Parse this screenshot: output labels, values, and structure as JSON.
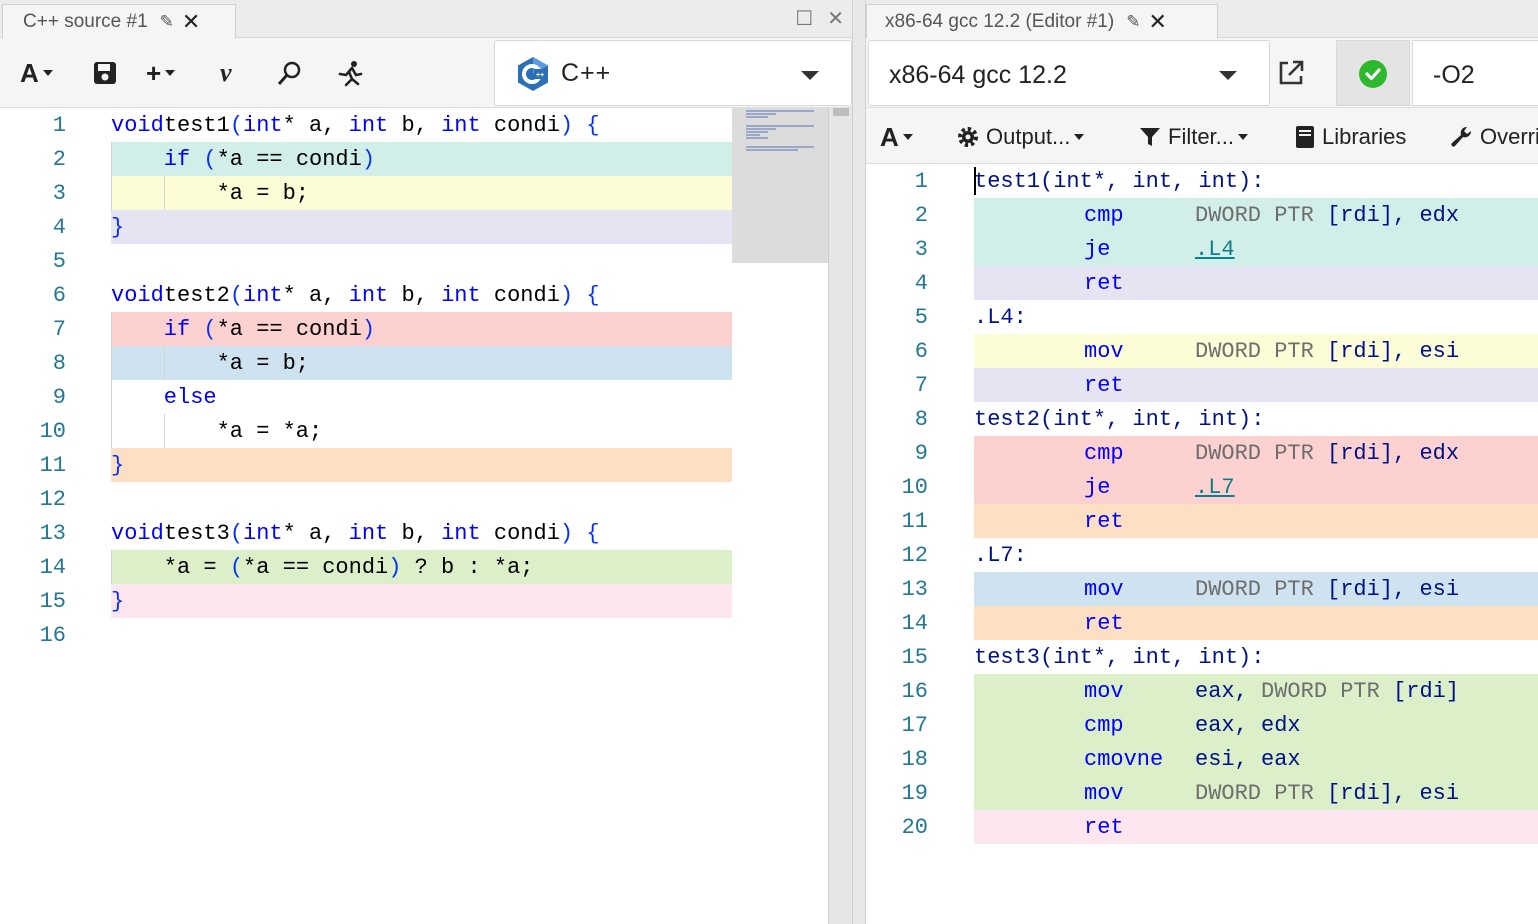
{
  "left_pane": {
    "tab": {
      "title": "C++ source #1"
    },
    "toolbar": {
      "language": "C++"
    },
    "source_lines": [
      {
        "n": "1",
        "hl": "",
        "indent": 0,
        "tokens": [
          [
            "kw",
            "void"
          ],
          [
            "",
            "test1"
          ],
          [
            "br",
            "("
          ],
          [
            "kw",
            "int"
          ],
          [
            "",
            "* a, "
          ],
          [
            "kw",
            "int"
          ],
          [
            "",
            " b, "
          ],
          [
            "kw",
            "int"
          ],
          [
            "",
            " condi"
          ],
          [
            "br",
            ")"
          ],
          [
            "",
            " "
          ],
          [
            "br",
            "{"
          ]
        ]
      },
      {
        "n": "2",
        "hl": "#d1efe8",
        "indent": 1,
        "tokens": [
          [
            "kw",
            "if"
          ],
          [
            "",
            " "
          ],
          [
            "br",
            "("
          ],
          [
            "",
            "*a == condi"
          ],
          [
            "br",
            ")"
          ]
        ]
      },
      {
        "n": "3",
        "hl": "#fcfcd6",
        "indent": 2,
        "tokens": [
          [
            "",
            "*a = b;"
          ]
        ]
      },
      {
        "n": "4",
        "hl": "#e6e3f2",
        "indent": 0,
        "tokens": [
          [
            "br",
            "}"
          ]
        ]
      },
      {
        "n": "5",
        "hl": "",
        "indent": 0,
        "tokens": []
      },
      {
        "n": "6",
        "hl": "",
        "indent": 0,
        "tokens": [
          [
            "kw",
            "void"
          ],
          [
            "",
            "test2"
          ],
          [
            "br",
            "("
          ],
          [
            "kw",
            "int"
          ],
          [
            "",
            "* a, "
          ],
          [
            "kw",
            "int"
          ],
          [
            "",
            " b, "
          ],
          [
            "kw",
            "int"
          ],
          [
            "",
            " condi"
          ],
          [
            "br",
            ")"
          ],
          [
            "",
            " "
          ],
          [
            "br",
            "{"
          ]
        ]
      },
      {
        "n": "7",
        "hl": "#fdd1cf",
        "indent": 1,
        "tokens": [
          [
            "kw",
            "if"
          ],
          [
            "",
            " "
          ],
          [
            "br",
            "("
          ],
          [
            "",
            "*a == condi"
          ],
          [
            "br",
            ")"
          ]
        ]
      },
      {
        "n": "8",
        "hl": "#cfe2ef",
        "indent": 2,
        "tokens": [
          [
            "",
            "*a = b;"
          ]
        ]
      },
      {
        "n": "9",
        "hl": "",
        "indent": 1,
        "tokens": [
          [
            "kw",
            "else"
          ]
        ]
      },
      {
        "n": "10",
        "hl": "",
        "indent": 2,
        "tokens": [
          [
            "",
            "*a = *a;"
          ]
        ]
      },
      {
        "n": "11",
        "hl": "#fde0c4",
        "indent": 0,
        "tokens": [
          [
            "br",
            "}"
          ]
        ]
      },
      {
        "n": "12",
        "hl": "",
        "indent": 0,
        "tokens": []
      },
      {
        "n": "13",
        "hl": "",
        "indent": 0,
        "tokens": [
          [
            "kw",
            "void"
          ],
          [
            "",
            "test3"
          ],
          [
            "br",
            "("
          ],
          [
            "kw",
            "int"
          ],
          [
            "",
            "* a, "
          ],
          [
            "kw",
            "int"
          ],
          [
            "",
            " b, "
          ],
          [
            "kw",
            "int"
          ],
          [
            "",
            " condi"
          ],
          [
            "br",
            ")"
          ],
          [
            "",
            " "
          ],
          [
            "br",
            "{"
          ]
        ]
      },
      {
        "n": "14",
        "hl": "#dbefc8",
        "indent": 1,
        "tokens": [
          [
            "",
            "*a = "
          ],
          [
            "br",
            "("
          ],
          [
            "",
            "*a == condi"
          ],
          [
            "br",
            ")"
          ],
          [
            "",
            " ? b : *a;"
          ]
        ]
      },
      {
        "n": "15",
        "hl": "#fde6f0",
        "indent": 0,
        "tokens": [
          [
            "br",
            "}"
          ]
        ]
      },
      {
        "n": "16",
        "hl": "",
        "indent": 0,
        "tokens": []
      }
    ]
  },
  "right_pane": {
    "tab": {
      "title": "x86-64 gcc 12.2 (Editor #1)"
    },
    "compiler": {
      "name": "x86-64 gcc 12.2",
      "options": "-O2"
    },
    "output_toolbar": {
      "output": "Output...",
      "filter": "Filter...",
      "libraries": "Libraries",
      "overrides": "Overrides"
    },
    "asm_lines": [
      {
        "n": "1",
        "hl": "",
        "label": "test1(int*, int, int):",
        "op": "",
        "args": []
      },
      {
        "n": "2",
        "hl": "#d1efe8",
        "label": "",
        "op": "cmp",
        "args": [
          [
            "ptr",
            "DWORD PTR "
          ],
          [
            "",
            "[rdi], edx"
          ]
        ]
      },
      {
        "n": "3",
        "hl": "#d1efe8",
        "label": "",
        "op": "je",
        "args": [
          [
            "link",
            ".L4"
          ]
        ]
      },
      {
        "n": "4",
        "hl": "#e6e3f2",
        "label": "",
        "op": "ret",
        "args": []
      },
      {
        "n": "5",
        "hl": "",
        "label": ".L4:",
        "op": "",
        "args": []
      },
      {
        "n": "6",
        "hl": "#fcfcd6",
        "label": "",
        "op": "mov",
        "args": [
          [
            "ptr",
            "DWORD PTR "
          ],
          [
            "",
            "[rdi], esi"
          ]
        ]
      },
      {
        "n": "7",
        "hl": "#e6e3f2",
        "label": "",
        "op": "ret",
        "args": []
      },
      {
        "n": "8",
        "hl": "",
        "label": "test2(int*, int, int):",
        "op": "",
        "args": []
      },
      {
        "n": "9",
        "hl": "#fdd1cf",
        "label": "",
        "op": "cmp",
        "args": [
          [
            "ptr",
            "DWORD PTR "
          ],
          [
            "",
            "[rdi], edx"
          ]
        ]
      },
      {
        "n": "10",
        "hl": "#fdd1cf",
        "label": "",
        "op": "je",
        "args": [
          [
            "link",
            ".L7"
          ]
        ]
      },
      {
        "n": "11",
        "hl": "#fde0c4",
        "label": "",
        "op": "ret",
        "args": []
      },
      {
        "n": "12",
        "hl": "",
        "label": ".L7:",
        "op": "",
        "args": []
      },
      {
        "n": "13",
        "hl": "#cfe2ef",
        "label": "",
        "op": "mov",
        "args": [
          [
            "ptr",
            "DWORD PTR "
          ],
          [
            "",
            "[rdi], esi"
          ]
        ]
      },
      {
        "n": "14",
        "hl": "#fde0c4",
        "label": "",
        "op": "ret",
        "args": []
      },
      {
        "n": "15",
        "hl": "",
        "label": "test3(int*, int, int):",
        "op": "",
        "args": []
      },
      {
        "n": "16",
        "hl": "#dbefc8",
        "label": "",
        "op": "mov",
        "args": [
          [
            "",
            "eax, "
          ],
          [
            "ptr",
            "DWORD PTR "
          ],
          [
            "",
            "[rdi]"
          ]
        ]
      },
      {
        "n": "17",
        "hl": "#dbefc8",
        "label": "",
        "op": "cmp",
        "args": [
          [
            "",
            "eax, edx"
          ]
        ]
      },
      {
        "n": "18",
        "hl": "#dbefc8",
        "label": "",
        "op": "cmovne",
        "args": [
          [
            "",
            "esi, eax"
          ]
        ]
      },
      {
        "n": "19",
        "hl": "#dbefc8",
        "label": "",
        "op": "mov",
        "args": [
          [
            "ptr",
            "DWORD PTR "
          ],
          [
            "",
            "[rdi], esi"
          ]
        ]
      },
      {
        "n": "20",
        "hl": "#fde6f0",
        "label": "",
        "op": "ret",
        "args": []
      }
    ]
  },
  "icons": {
    "font_size": "font-size-icon",
    "save": "save-icon",
    "add": "plus-icon",
    "vim": "vim-icon",
    "search": "search-icon",
    "run": "runner-icon",
    "edit_title": "pencil-icon",
    "close": "close-icon",
    "maximize": "maximize-icon",
    "popout": "external-link-icon",
    "status": "check-circle-icon",
    "settings": "gear-icon",
    "filter": "funnel-icon",
    "libraries": "book-icon",
    "overrides": "wrench-icon"
  },
  "colors": {
    "keyword": "#0000ff",
    "line_number": "#237893",
    "label": "#001188",
    "success": "#2eb82e"
  }
}
